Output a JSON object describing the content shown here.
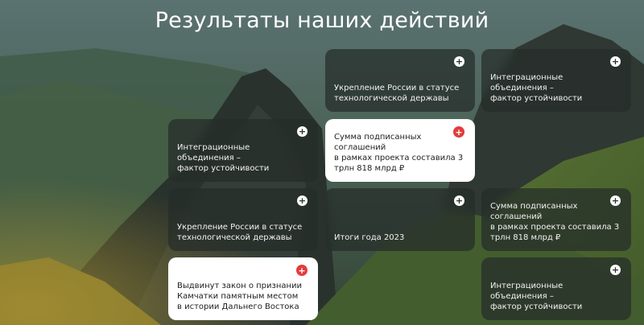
{
  "page": {
    "title": "Результаты наших действий"
  },
  "cards": [
    {
      "text": "Укрепление России в статусе\nтехнологической державы",
      "style": "dark"
    },
    {
      "text": "Интеграционные объединения –\nфактор устойчивости",
      "style": "dark"
    },
    {
      "text": "Интеграционные объединения –\nфактор устойчивости",
      "style": "dark"
    },
    {
      "text": "Сумма подписанных соглашений\nв рамках проекта составила 3\nтрлн 818 млрд ₽",
      "style": "light"
    },
    {
      "text": "Укрепление России в статусе\nтехнологической державы",
      "style": "dark"
    },
    {
      "text": "Итоги года 2023",
      "style": "dark"
    },
    {
      "text": "Сумма подписанных соглашений\nв рамках проекта составила 3\nтрлн 818 млрд ₽",
      "style": "dark"
    },
    {
      "text": "Выдвинут закон о признании\nКамчатки памятным местом\nв истории Дальнего Востока",
      "style": "light"
    },
    {
      "text": "Интеграционные объединения –\nфактор устойчивости",
      "style": "dark"
    }
  ],
  "icons": {
    "expand": "+"
  },
  "colors": {
    "accent": "#e23c3c",
    "card_dark": "#262c29",
    "card_light": "#ffffff",
    "title": "#ffffff"
  }
}
